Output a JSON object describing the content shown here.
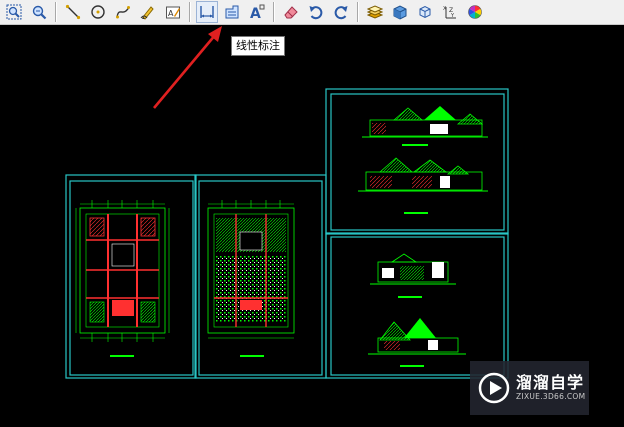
{
  "toolbar": {
    "buttons": [
      {
        "name": "zoom-window-icon"
      },
      {
        "name": "zoom-realtime-icon"
      },
      {
        "name": "line-icon"
      },
      {
        "name": "circle-icon"
      },
      {
        "name": "spline-icon"
      },
      {
        "name": "pencil-icon"
      },
      {
        "name": "text-edit-icon"
      },
      {
        "name": "linear-dimension-icon"
      },
      {
        "name": "area-icon"
      },
      {
        "name": "text-icon"
      },
      {
        "name": "eraser-icon"
      },
      {
        "name": "undo-icon"
      },
      {
        "name": "redo-icon"
      },
      {
        "name": "layers-icon"
      },
      {
        "name": "3d-box-icon"
      },
      {
        "name": "3d-orbit-icon"
      },
      {
        "name": "coordinate-icon"
      },
      {
        "name": "color-wheel-icon"
      }
    ],
    "active": "linear-dimension-icon"
  },
  "tooltip": {
    "text": "线性标注"
  },
  "canvas": {
    "background": "#000000",
    "frame_color": "#29c4c4",
    "drawing_color": "#00ff00",
    "accent_color": "#ff2222",
    "arrow_color": "#e02020"
  },
  "watermark": {
    "name_cn": "溜溜自学",
    "url": "ZIXUE.3D66.COM"
  }
}
